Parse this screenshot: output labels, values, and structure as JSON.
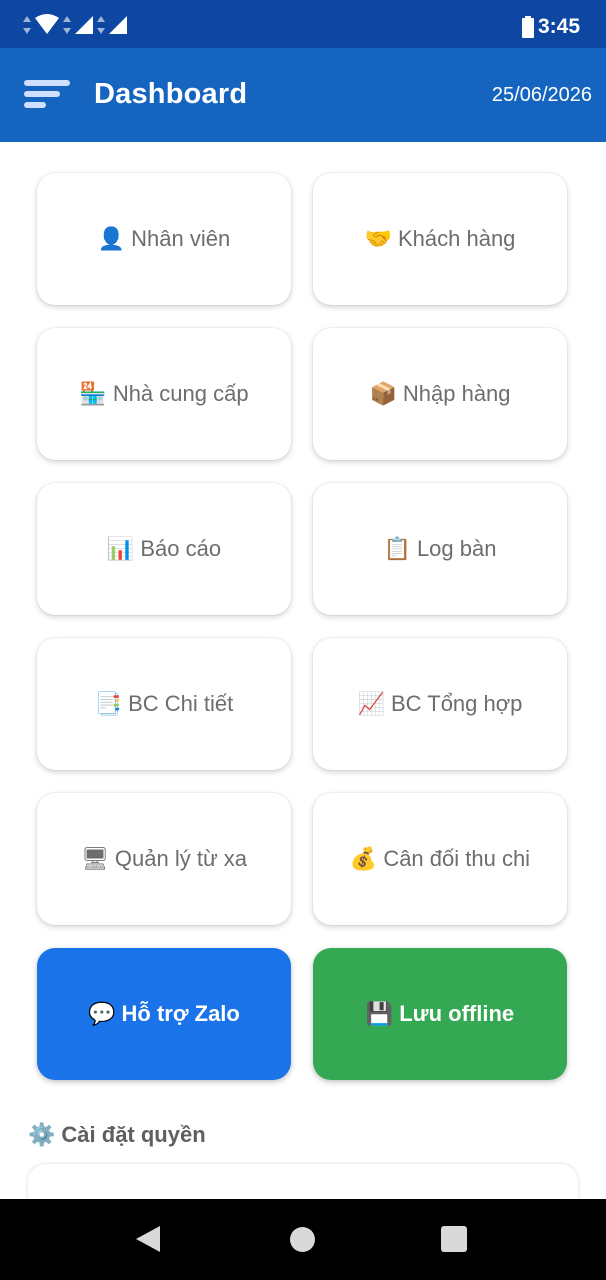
{
  "status_bar": {
    "time": "3:45",
    "icons": [
      "data-arrows-icon",
      "wifi-icon",
      "data-arrows-icon",
      "signal-icon",
      "data-arrows-icon",
      "signal-icon",
      "battery-icon"
    ]
  },
  "app_bar": {
    "title": "Dashboard",
    "date": "25/06/2026",
    "menu_icon": "menu-icon"
  },
  "menu": {
    "items": [
      {
        "icon": "👤",
        "label": "Nhân viên"
      },
      {
        "icon": "🤝",
        "label": "Khách hàng"
      },
      {
        "icon": "🏪",
        "label": "Nhà cung cấp"
      },
      {
        "icon": "📦",
        "label": "Nhập hàng"
      },
      {
        "icon": "📊",
        "label": "Báo cáo"
      },
      {
        "icon": "📋",
        "label": "Log bàn"
      },
      {
        "icon": "📑",
        "label": "BC Chi tiết"
      },
      {
        "icon": "📈",
        "label": "BC Tổng hợp"
      },
      {
        "icon": "🖥",
        "label": "Quản lý từ xa"
      },
      {
        "icon": "💰",
        "label": "Cân đối thu chi"
      }
    ]
  },
  "actions": {
    "zalo": {
      "icon": "💬",
      "label": "Hỗ trợ Zalo",
      "color": "#1a73e8"
    },
    "offline": {
      "icon": "💾",
      "label": "Lưu offline",
      "color": "#34a853"
    }
  },
  "settings": {
    "icon": "⚙️",
    "title": "Cài đặt quyền"
  },
  "colors": {
    "status_bar": "#0d47a1",
    "app_bar": "#1565c0"
  }
}
